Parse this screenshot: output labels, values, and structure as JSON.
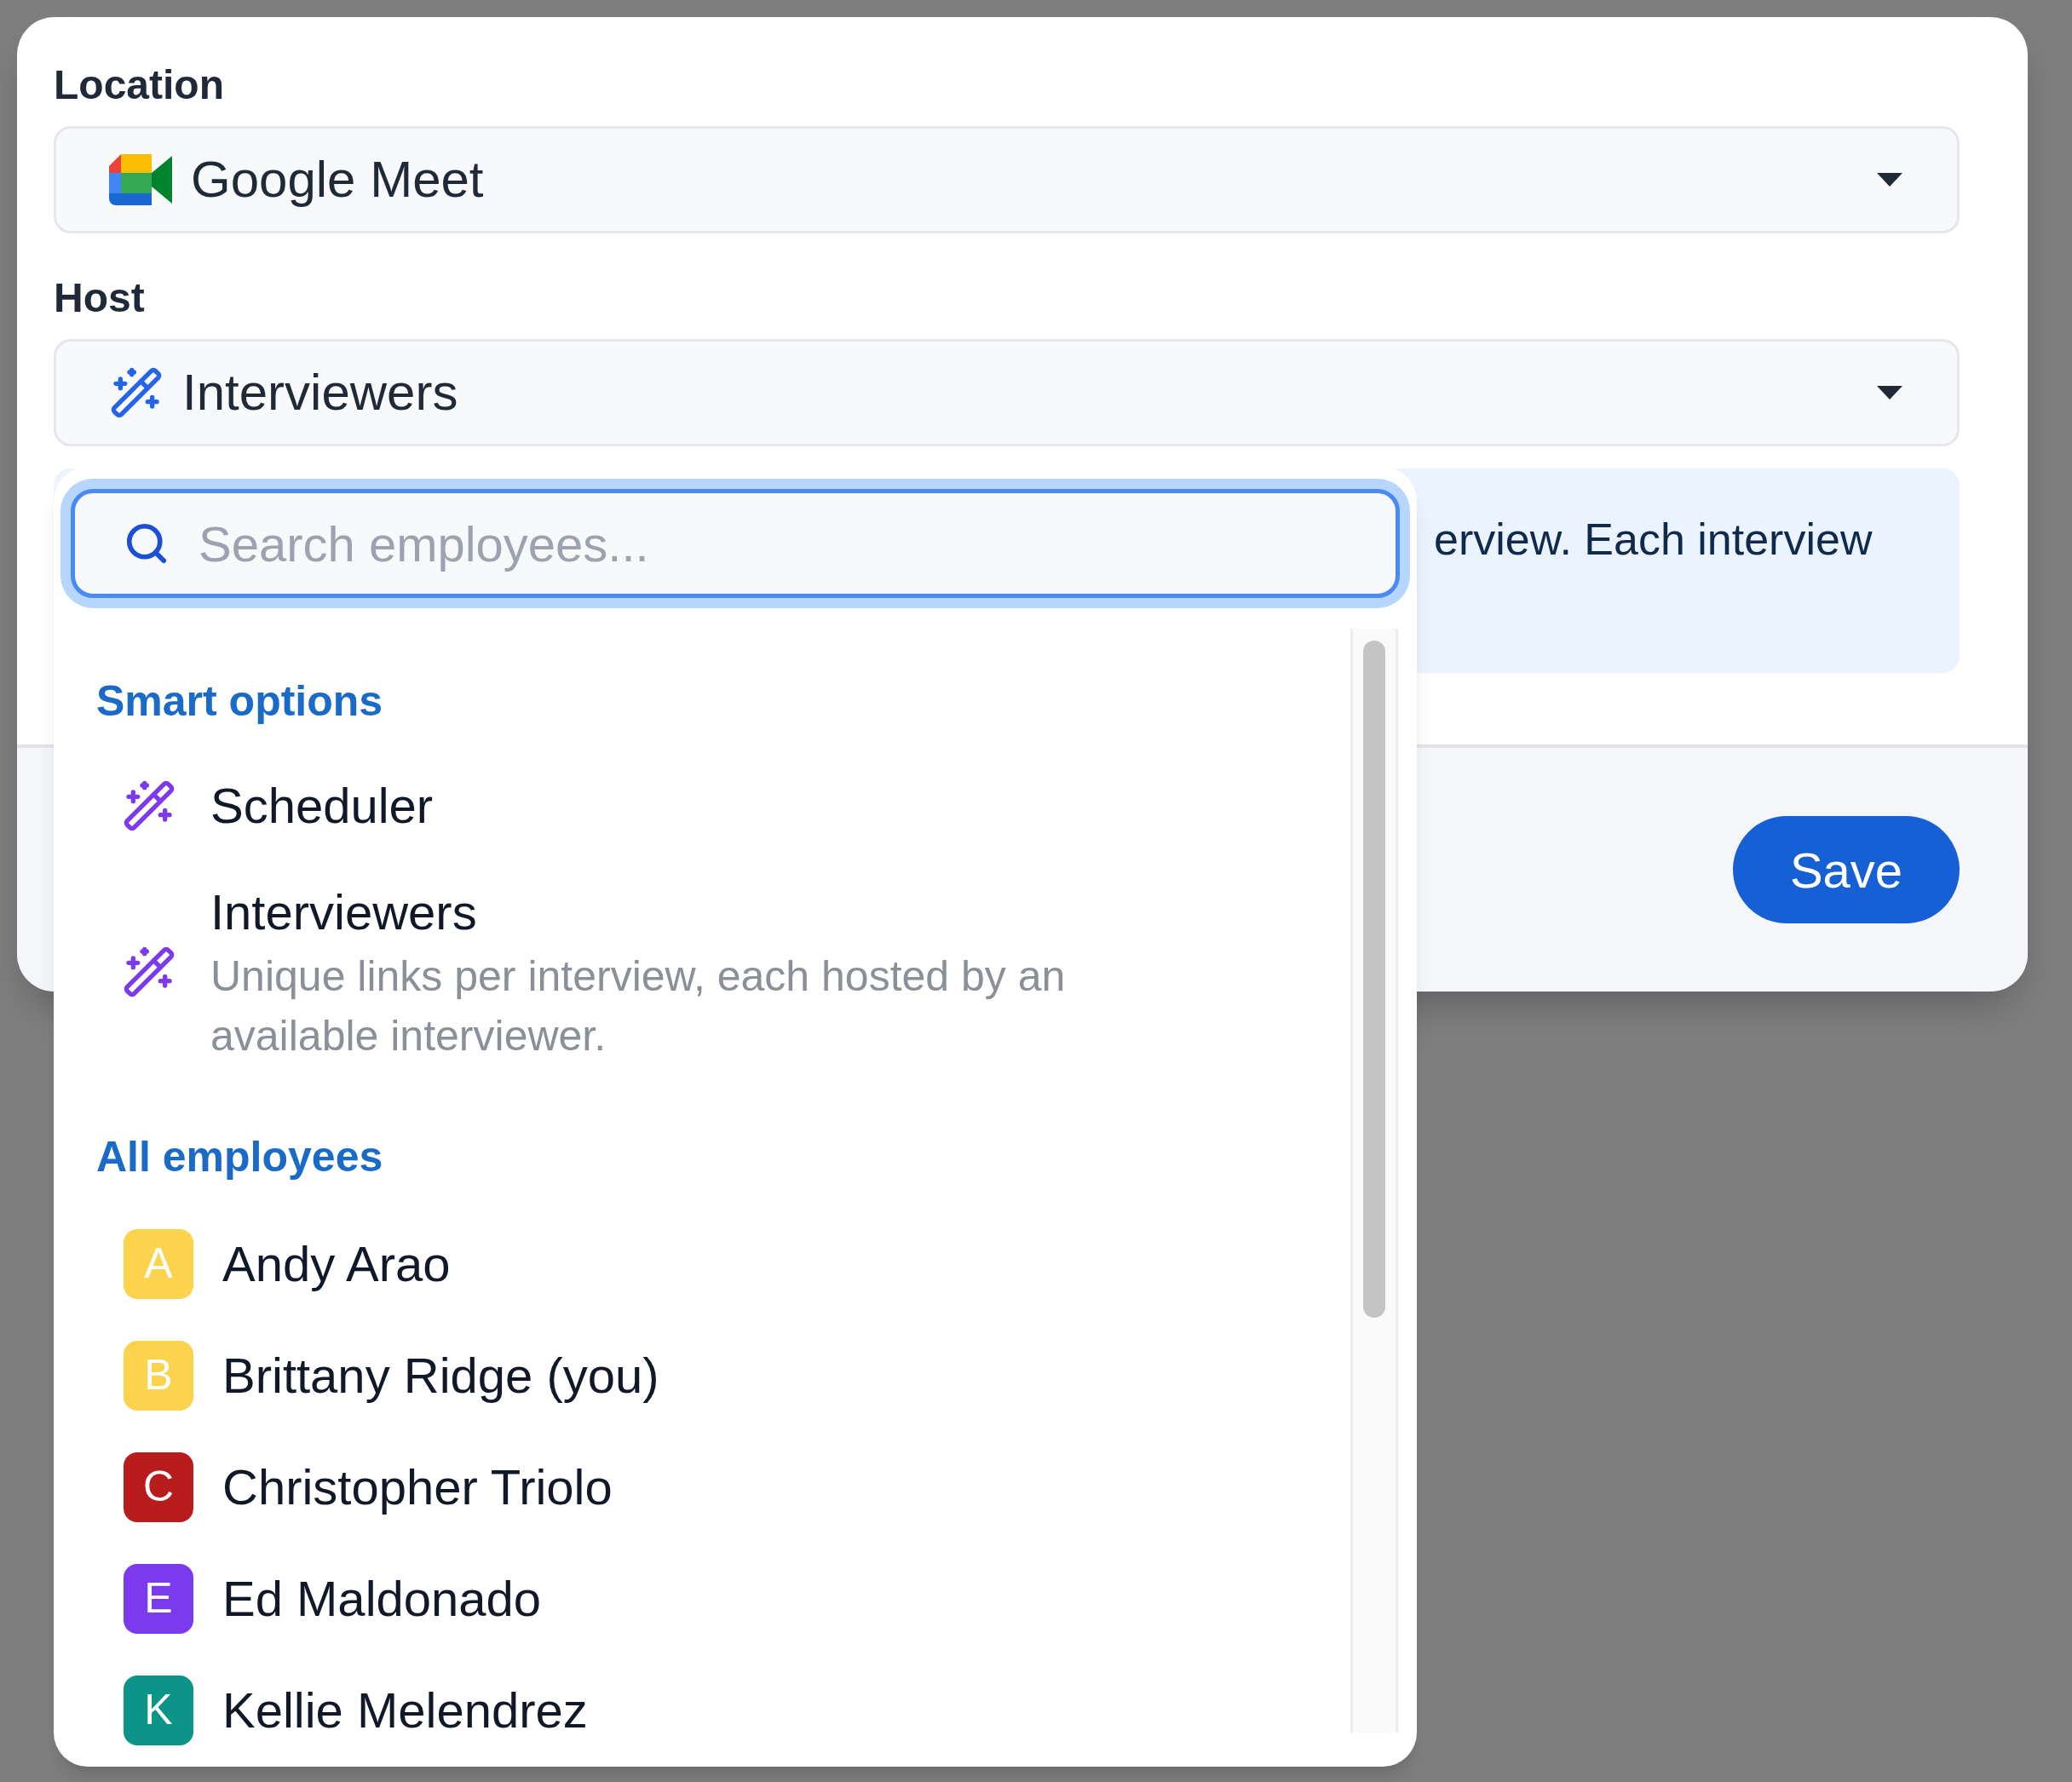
{
  "location": {
    "label": "Location",
    "value": "Google Meet"
  },
  "host": {
    "label": "Host",
    "value": "Interviewers"
  },
  "info_text": "erview. Each interview",
  "save_button": "Save",
  "dropdown": {
    "search": {
      "placeholder": "Search employees..."
    },
    "sections": [
      {
        "title": "Smart options",
        "items": [
          {
            "kind": "smart",
            "name": "Scheduler"
          },
          {
            "kind": "smart",
            "name": "Interviewers",
            "description": "Unique links per interview, each hosted by an available interviewer."
          }
        ]
      },
      {
        "title": "All employees",
        "items": [
          {
            "kind": "employee",
            "initial": "A",
            "name": "Andy Arao",
            "color": "#fcd34d"
          },
          {
            "kind": "employee",
            "initial": "B",
            "name": "Brittany Ridge (you)",
            "color": "#fcd34d"
          },
          {
            "kind": "employee",
            "initial": "C",
            "name": "Christopher Triolo",
            "color": "#b91c1c"
          },
          {
            "kind": "employee",
            "initial": "E",
            "name": "Ed Maldonado",
            "color": "#7c3aed"
          },
          {
            "kind": "employee",
            "initial": "K",
            "name": "Kellie Melendrez",
            "color": "#0d9488"
          }
        ]
      }
    ]
  }
}
